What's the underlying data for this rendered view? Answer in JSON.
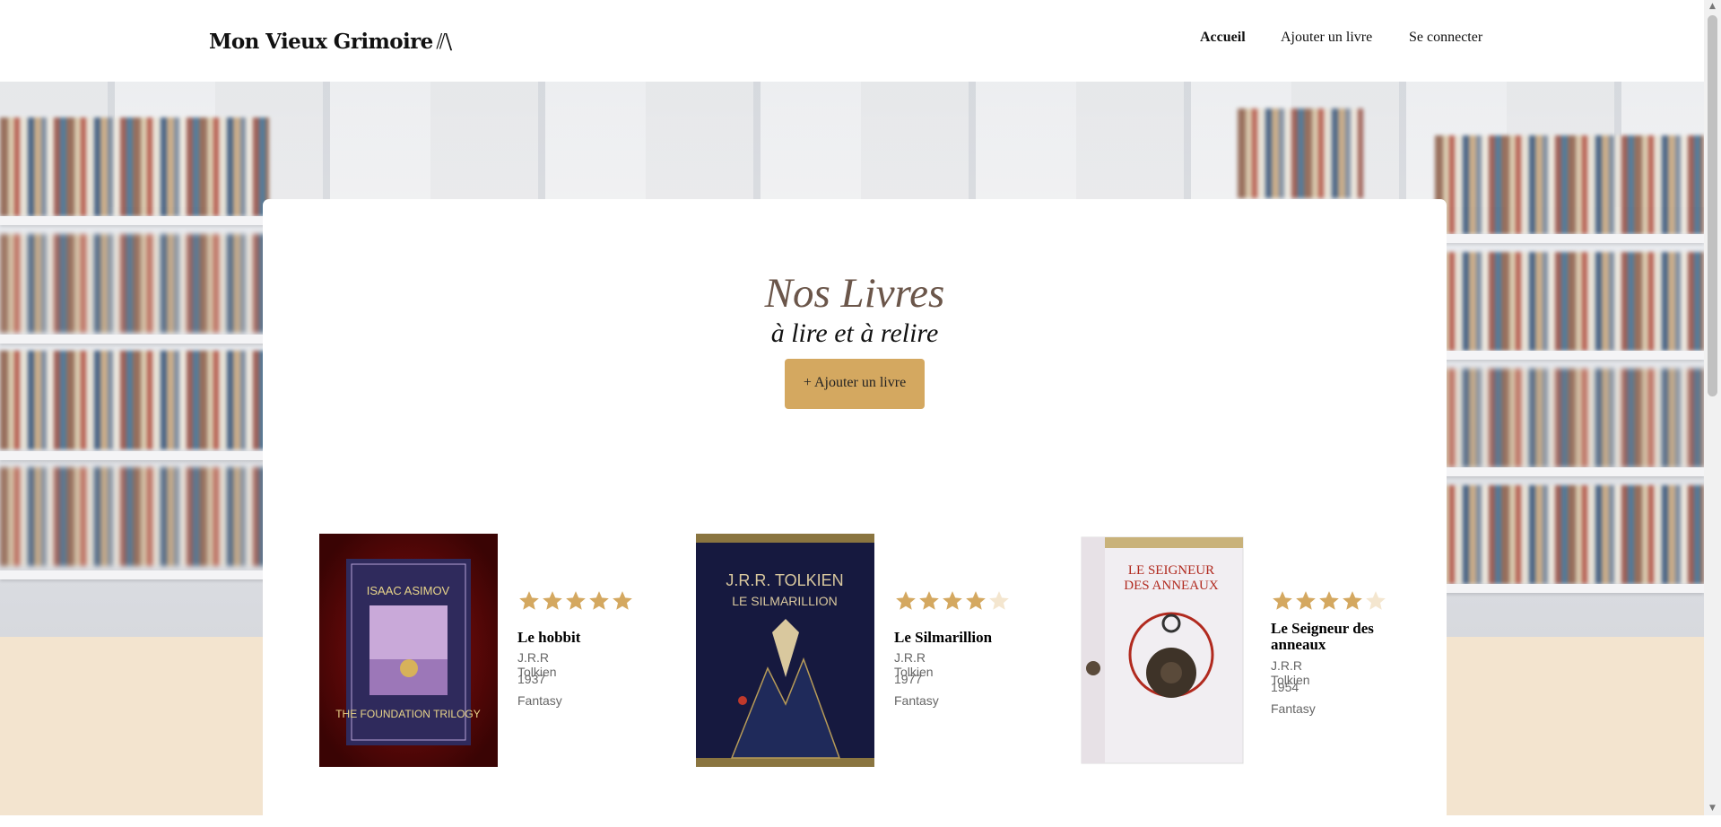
{
  "header": {
    "logo_text": "Mon Vieux Grimoire",
    "logo_icon": "books-icon",
    "nav": [
      {
        "label": "Accueil",
        "active": true
      },
      {
        "label": "Ajouter un livre",
        "active": false
      },
      {
        "label": "Se connecter",
        "active": false
      }
    ]
  },
  "hero": {
    "title": "Nos Livres",
    "subtitle": "à lire et à relire",
    "add_button": "+ Ajouter un livre"
  },
  "books": [
    {
      "title": "Le hobbit",
      "author": "J.R.R Tolkien",
      "year": "1937",
      "genre": "Fantasy",
      "rating": 5,
      "cover_text": [
        "ISAAC ASIMOV",
        "THE FOUNDATION TRILOGY"
      ]
    },
    {
      "title": "Le Silmarillion",
      "author": "J.R.R Tolkien",
      "year": "1977",
      "genre": "Fantasy",
      "rating": 4,
      "cover_text": [
        "J.R.R. TOLKIEN",
        "LE SILMARILLION"
      ]
    },
    {
      "title": "Le Seigneur des anneaux",
      "author": "J.R.R Tolkien",
      "year": "1954",
      "genre": "Fantasy",
      "rating": 4,
      "cover_text": [
        "LE SEIGNEUR",
        "DES ANNEAUX"
      ]
    }
  ],
  "colors": {
    "accent": "#d4a860",
    "star_filled": "#d4a860",
    "star_empty": "#f4e6cf",
    "title_color": "#6b564a",
    "beige_band": "#f3e4cf"
  }
}
